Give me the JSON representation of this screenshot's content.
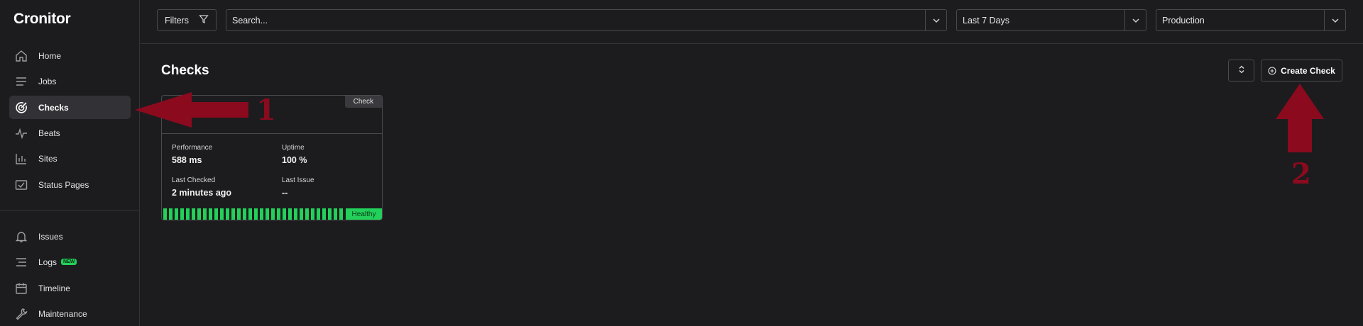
{
  "app": {
    "name": "Cronitor"
  },
  "sidebar": {
    "items": [
      {
        "label": "Home",
        "icon": "home-icon"
      },
      {
        "label": "Jobs",
        "icon": "list-icon"
      },
      {
        "label": "Checks",
        "icon": "target-icon",
        "active": true
      },
      {
        "label": "Beats",
        "icon": "pulse-icon"
      },
      {
        "label": "Sites",
        "icon": "bar-chart-icon"
      },
      {
        "label": "Status Pages",
        "icon": "status-page-icon"
      },
      {
        "label": "Issues",
        "icon": "bell-icon"
      },
      {
        "label": "Logs",
        "icon": "logs-icon",
        "badge": "NEW"
      },
      {
        "label": "Timeline",
        "icon": "calendar-icon"
      },
      {
        "label": "Maintenance",
        "icon": "wrench-icon"
      }
    ]
  },
  "topbar": {
    "filters_label": "Filters",
    "search_value": "Search...",
    "time_range": "Last 7 Days",
    "environment": "Production"
  },
  "main": {
    "title": "Checks",
    "create_label": "Create Check"
  },
  "card": {
    "type_badge": "Check",
    "performance_label": "Performance",
    "performance_value": "588 ms",
    "uptime_label": "Uptime",
    "uptime_value": "100 %",
    "last_checked_label": "Last Checked",
    "last_checked_value": "2 minutes ago",
    "last_issue_label": "Last Issue",
    "last_issue_value": "--",
    "health_label": "Healthy"
  },
  "annotations": {
    "first": "1",
    "second": "2"
  },
  "colors": {
    "healthy": "#22d05a",
    "annotation": "#8b0a1e",
    "background": "#1c1c1e"
  }
}
